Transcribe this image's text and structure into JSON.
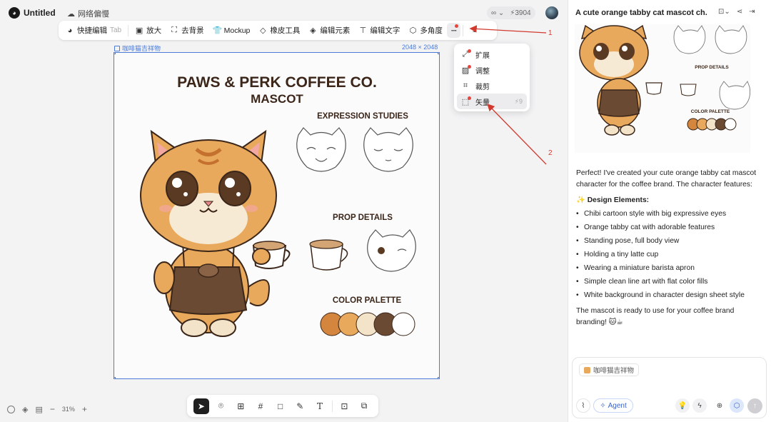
{
  "top_bar": {
    "title": "Untitled",
    "network_status": "网络偏慢",
    "credits_mode": "∞",
    "credits": "3904"
  },
  "toolbar": {
    "quick_edit": "快捷编辑",
    "quick_edit_hint": "Tab",
    "upscale": "放大",
    "remove_bg": "去背景",
    "mockup": "Mockup",
    "eraser": "橡皮工具",
    "edit_elements": "编辑元素",
    "edit_text": "编辑文字",
    "multi_angle": "多角度",
    "more": "···"
  },
  "canvas": {
    "image_label": "咖啡猫吉祥物",
    "image_dims": "2048 × 2048",
    "artwork": {
      "title_line1": "PAWS & PERK COFFEE CO.",
      "title_line2": "MASCOT",
      "section_expression": "EXPRESSION STUDIES",
      "section_prop": "PROP DETAILS",
      "section_palette": "COLOR PALETTE",
      "palette_colors": [
        "#d4863f",
        "#e9a95c",
        "#f3e3c8",
        "#6a4a33",
        "#ffffff"
      ]
    }
  },
  "more_menu": {
    "items": [
      {
        "label": "扩展"
      },
      {
        "label": "调整"
      },
      {
        "label": "裁剪"
      },
      {
        "label": "矢量",
        "cost": "9"
      }
    ]
  },
  "annotations": {
    "arrow1_label": "1",
    "arrow2_label": "2",
    "color": "#d23a2f"
  },
  "bottom_bar": {
    "zoom": "31%"
  },
  "chat": {
    "title": "A cute orange tabby cat mascot ch...",
    "intro": "Perfect! I've created your cute orange tabby cat mascot character for the coffee brand. The character features:",
    "design_heading": "Design Elements:",
    "bullets": [
      "Chibi cartoon style with big expressive eyes",
      "Orange tabby cat with adorable features",
      "Standing pose, full body view",
      "Holding a tiny latte cup",
      "Wearing a miniature barista apron",
      "Simple clean line art with flat color fills",
      "White background in character design sheet style"
    ],
    "closing": "The mascot is ready to use for your coffee brand branding! 🐱☕",
    "composer_chip": "咖啡猫吉祥物",
    "agent_label": "Agent"
  }
}
